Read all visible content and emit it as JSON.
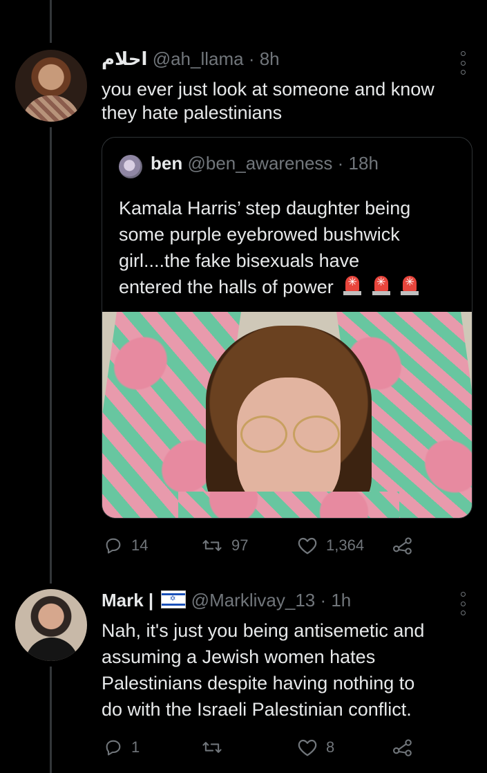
{
  "tweet1": {
    "display_name": "احلام",
    "handle": "@ah_llama",
    "time": "· 8h",
    "text_line1": "you ever just look at someone and know",
    "text_line2": "they hate palestinians",
    "quote": {
      "display_name": "ben",
      "handle": "@ben_awareness",
      "time": "· 18h",
      "text_line1": "Kamala Harris’ step daughter being",
      "text_line2": "some purple eyebrowed bushwick",
      "text_line3": "girl....the fake bisexuals have",
      "text_line4": "entered the halls of power",
      "emoji": "police-light-emoji"
    },
    "replies": "14",
    "retweets": "97",
    "likes": "1,364"
  },
  "tweet2": {
    "display_name": "Mark |",
    "flag": "israel-flag-emoji",
    "handle": "@Marklivay_13",
    "time": "· 1h",
    "text_line1": "Nah, it's just you being antisemetic and",
    "text_line2": "assuming a Jewish women hates",
    "text_line3": "Palestinians despite having nothing to",
    "text_line4": "do with the Israeli Palestinian conflict.",
    "replies": "1",
    "retweets": "",
    "likes": "8"
  },
  "colors": {
    "background": "#000000",
    "text": "#e7e9ea",
    "muted": "#71767b",
    "border": "#2f3336"
  }
}
